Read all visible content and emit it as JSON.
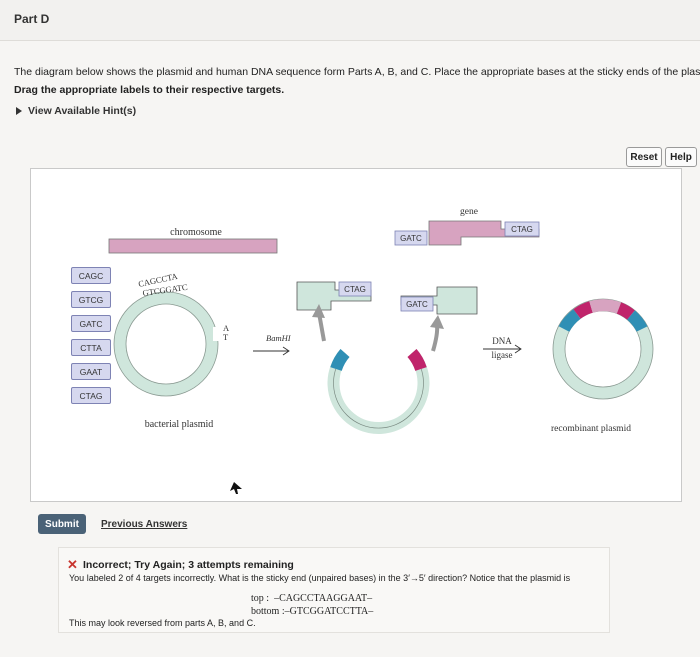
{
  "header": {
    "part_title": "Part D"
  },
  "question": {
    "intro": "The diagram below shows the plasmid and human DNA sequence form Parts A, B, and C. Place the appropriate bases at the sticky ends of the plasmid",
    "instruction": "Drag the appropriate labels to their respective targets.",
    "hints_label": "View Available Hint(s)"
  },
  "toolbar": {
    "reset_label": "Reset",
    "help_label": "Help"
  },
  "labels_bank": [
    "CAGC",
    "GTCG",
    "GATC",
    "CTTA",
    "GAAT",
    "CTAG"
  ],
  "diagram": {
    "chromosome_label": "chromosome",
    "gene_label": "gene",
    "bamhi_label": "BamHI",
    "dna_label": "DNA",
    "ligase_label": "ligase",
    "bacterial_plasmid_label": "bacterial plasmid",
    "recombinant_plasmid_label": "recombinant plasmid",
    "seq_top": "CAGCCTA",
    "seq_bottom": "GTCGGATC",
    "seq_tail_top": "A",
    "seq_tail_bottom": "T",
    "placed": {
      "gene_left": "GATC",
      "gene_right": "CTAG",
      "frag_left": "CTAG",
      "frag_right": "GATC"
    },
    "colors": {
      "chromosome": "#d7a3c0",
      "plasmid": "#cfe6dc",
      "sticky_blue": "#2f8fb5",
      "sticky_red": "#c0246b",
      "chip_fill": "#d6d8ef",
      "chip_border": "#7e83b4"
    }
  },
  "actions": {
    "submit_label": "Submit",
    "previous_answers_label": "Previous Answers"
  },
  "feedback": {
    "icon": "x-icon",
    "title": "Incorrect; Try Again; 3 attempts remaining",
    "line1": "You labeled 2 of 4 targets incorrectly. What is the sticky end (unpaired bases) in the 3′→5′ direction? Notice that the plasmid is",
    "top_label": "top :",
    "top_seq": "–CAGCCTAAGGAAT–",
    "bottom_label": "bottom :",
    "bottom_seq": "–GTCGGATCCTTA–",
    "line2": "This may look reversed from parts A, B, and C."
  }
}
